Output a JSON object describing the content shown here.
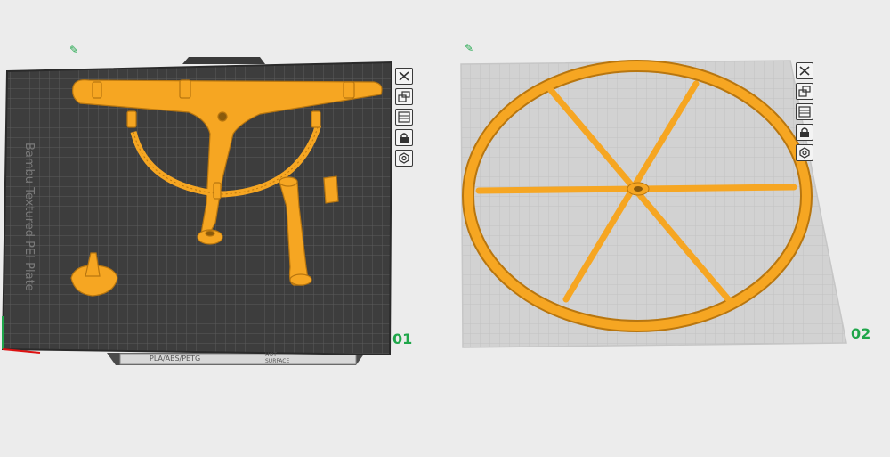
{
  "plates": [
    {
      "number": "01",
      "name_edit_icon": "pencil-icon",
      "bed_texture_text": "Bambu Textured PEI Plate",
      "bed_material_text": "PLA/ABS/PETG",
      "bed_hot_text": "HOT",
      "bed_surface_text": "SURFACE",
      "toolbar": [
        "close-icon",
        "arrange-icon",
        "orient-icon",
        "lock-icon",
        "settings-icon"
      ]
    },
    {
      "number": "02",
      "name_edit_icon": "pencil-icon",
      "toolbar": [
        "close-icon",
        "arrange-icon",
        "orient-icon",
        "lock-icon",
        "settings-icon"
      ]
    }
  ],
  "colors": {
    "model": "#f6a622",
    "model_edge": "#b8760f",
    "plate1_bed": "#3d3d3d",
    "plate1_grid": "#5a5a5a",
    "plate2_bed": "#d2d2d2",
    "plate2_grid": "#c0c0c0",
    "plate_number": "#1fa64a"
  }
}
